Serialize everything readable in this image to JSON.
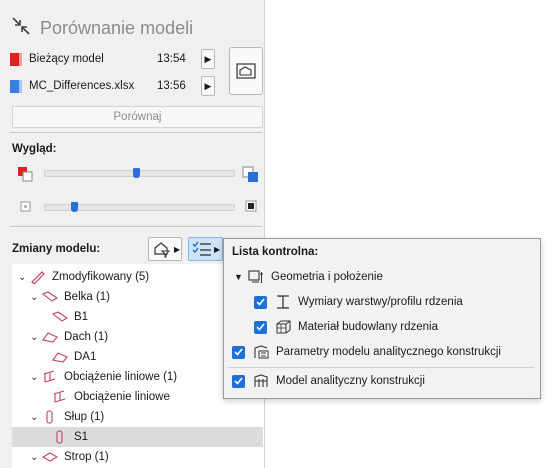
{
  "window": {
    "title": "Porównanie modeli"
  },
  "models": [
    {
      "label": "Bieżący model",
      "time": "13:54",
      "color": "#e32020"
    },
    {
      "label": "MC_Differences.xlsx",
      "time": "13:56",
      "color": "#3b7de0"
    }
  ],
  "compare_button": "Porównaj",
  "appearance": {
    "label": "Wygląd:",
    "slider_color_level": 0.49,
    "slider_opacity_level": 0.16
  },
  "changes": {
    "label": "Zmiany modelu:"
  },
  "tree": [
    {
      "label": "Zmodyfikowany (5)",
      "indent": 0,
      "expanded": true,
      "icon": "pencil-icon"
    },
    {
      "label": "Belka (1)",
      "indent": 1,
      "expanded": true,
      "icon": "beam-icon"
    },
    {
      "label": "B1",
      "indent": 2,
      "icon": "beam-icon"
    },
    {
      "label": "Dach (1)",
      "indent": 1,
      "expanded": true,
      "icon": "roof-icon"
    },
    {
      "label": "DA1",
      "indent": 2,
      "icon": "roof-icon"
    },
    {
      "label": "Obciążenie liniowe (1)",
      "indent": 1,
      "expanded": true,
      "icon": "line-load-icon"
    },
    {
      "label": "Obciążenie liniowe",
      "indent": 2,
      "icon": "line-load-icon"
    },
    {
      "label": "Słup (1)",
      "indent": 1,
      "expanded": true,
      "icon": "column-icon"
    },
    {
      "label": "S1",
      "indent": 2,
      "icon": "column-icon",
      "selected": true
    },
    {
      "label": "Strop (1)",
      "indent": 1,
      "expanded": true,
      "icon": "slab-icon"
    }
  ],
  "checklist": {
    "title": "Lista kontrolna:",
    "items": [
      {
        "label": "Geometria i położenie",
        "type": "group",
        "icon": "geometry-icon"
      },
      {
        "label": "Wymiary warstwy/profilu rdzenia",
        "checked": true,
        "icon": "profile-icon"
      },
      {
        "label": "Materiał budowlany rdzenia",
        "checked": true,
        "icon": "material-icon"
      },
      {
        "label": "Parametry modelu analitycznego konstrukcji",
        "checked": true,
        "icon": "parameters-icon"
      },
      {
        "label": "Model analityczny konstrukcji",
        "checked": true,
        "icon": "analytical-model-icon"
      }
    ]
  }
}
